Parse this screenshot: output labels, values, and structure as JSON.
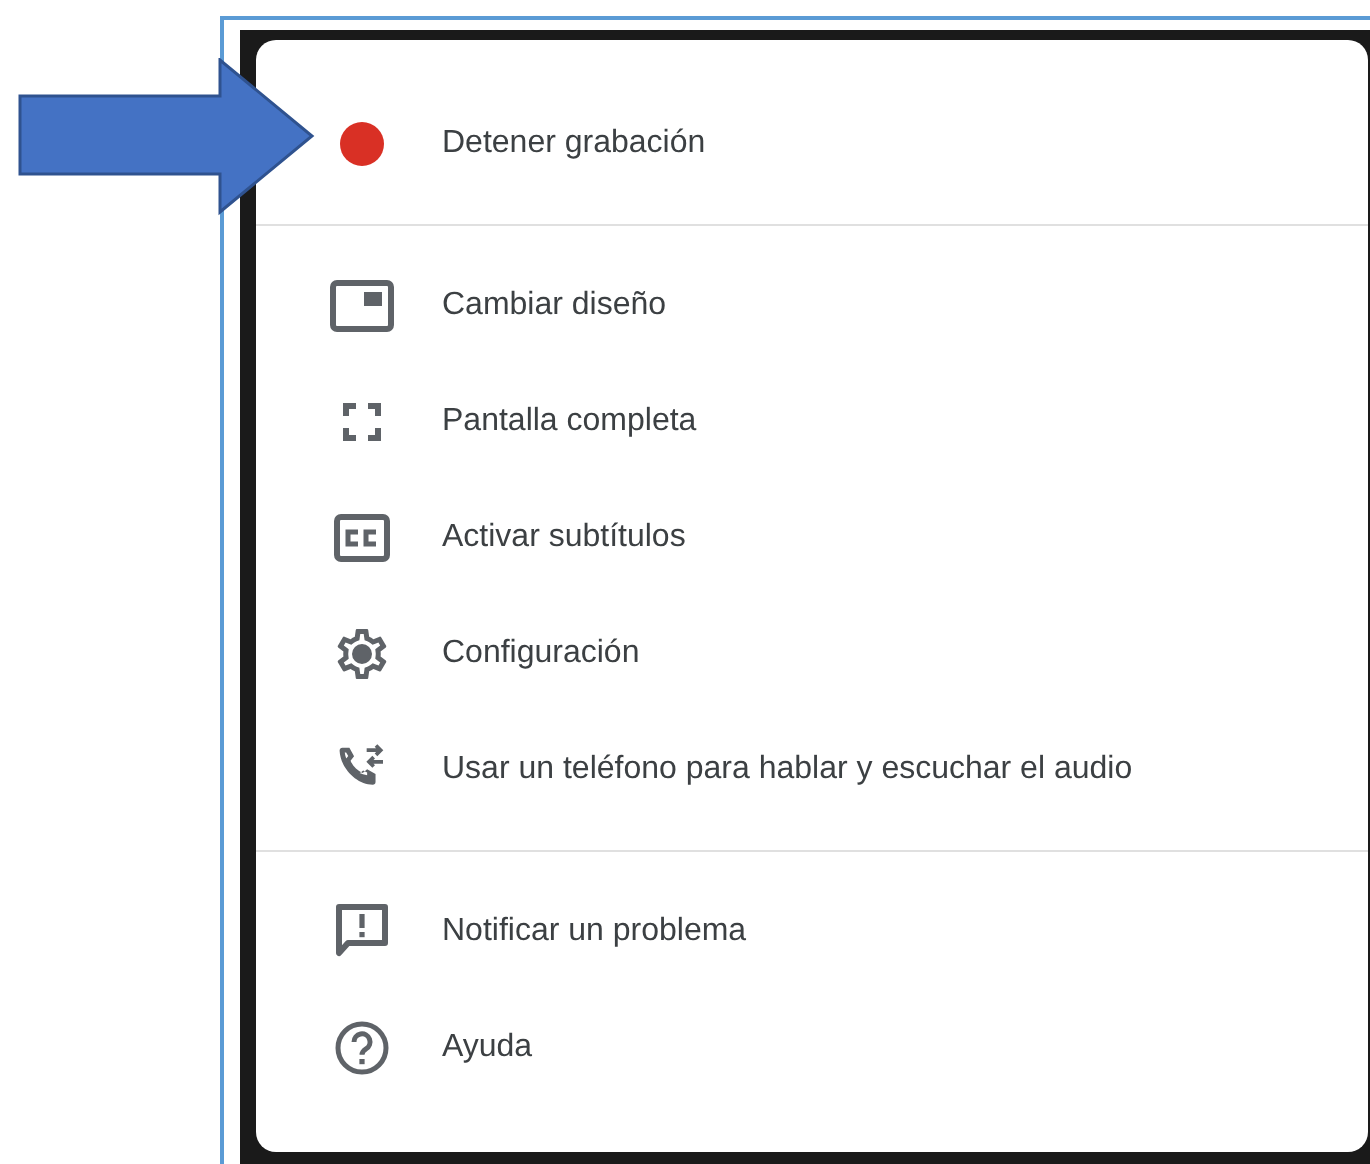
{
  "menu": {
    "sections": [
      {
        "items": [
          {
            "kind": "record",
            "label": "Detener grabación"
          }
        ]
      },
      {
        "items": [
          {
            "kind": "layout",
            "label": "Cambiar diseño"
          },
          {
            "kind": "fullscreen",
            "label": "Pantalla completa"
          },
          {
            "kind": "captions",
            "label": "Activar subtítulos"
          },
          {
            "kind": "settings",
            "label": "Configuración"
          },
          {
            "kind": "phone",
            "label": "Usar un teléfono para hablar y escuchar el audio"
          }
        ]
      },
      {
        "items": [
          {
            "kind": "report",
            "label": "Notificar un problema"
          },
          {
            "kind": "help",
            "label": "Ayuda"
          }
        ]
      }
    ]
  }
}
